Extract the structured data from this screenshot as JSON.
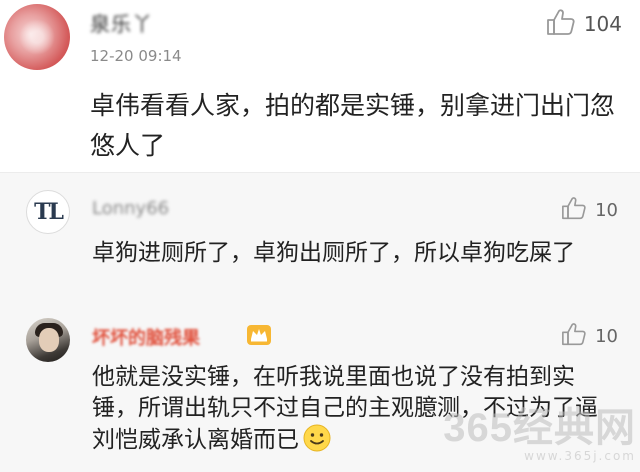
{
  "main_comment": {
    "username": "泉乐丫",
    "timestamp": "12-20 09:14",
    "like_count": "104",
    "text": "卓伟看看人家，拍的都是实锤，别拿进门出门忽悠人了"
  },
  "replies": [
    {
      "username": "Lonny66",
      "avatar_text": "TL",
      "like_count": "10",
      "text": "卓狗进厕所了，卓狗出厕所了，所以卓狗吃屎了"
    },
    {
      "username": "坏坏的脑残果",
      "like_count": "10",
      "text": "他就是没实锤，在听我说里面也说了没有拍到实锤，所谓出轨只不过自己的主观臆测，不过为了逼刘恺威承认离婚而已"
    }
  ],
  "icons": {
    "like": "thumbs-up-icon",
    "vip": "crown-badge-icon",
    "emoji": "smile-emoji-icon"
  },
  "colors": {
    "vip_username": "#e0503c",
    "reply_background": "#f7f7f7"
  },
  "watermark": {
    "main": "365经典网",
    "sub": "www.365j.com"
  }
}
